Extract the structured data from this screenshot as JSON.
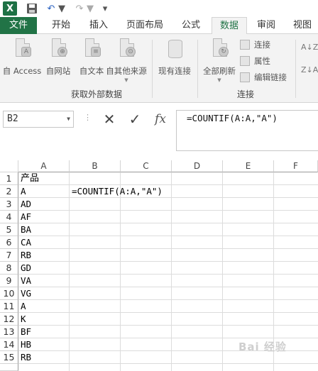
{
  "app": {
    "logo_letter": "X"
  },
  "quick_access": {
    "save_icon": "save-icon",
    "undo_icon": "undo-icon",
    "redo_icon": "redo-icon"
  },
  "tabs": [
    {
      "label": "文件"
    },
    {
      "label": "开始"
    },
    {
      "label": "插入"
    },
    {
      "label": "页面布局"
    },
    {
      "label": "公式"
    },
    {
      "label": "数据",
      "active": true
    },
    {
      "label": "审阅"
    },
    {
      "label": "视图"
    }
  ],
  "ribbon": {
    "get_external": {
      "label": "获取外部数据",
      "buttons": [
        {
          "label": "自 Access",
          "icon": "access-icon",
          "badge": "A"
        },
        {
          "label": "自网站",
          "icon": "web-icon",
          "badge": "⊕"
        },
        {
          "label": "自文本",
          "icon": "text-file-icon",
          "badge": "≡"
        },
        {
          "label": "自其他来源",
          "icon": "other-sources-icon",
          "badge": "⊙"
        }
      ]
    },
    "existing_connections": {
      "label": "现有连接",
      "icon": "database-icon"
    },
    "connections": {
      "label": "连接",
      "refresh_all": "全部刷新",
      "small": [
        {
          "label": "连接",
          "icon": "connections-icon"
        },
        {
          "label": "属性",
          "icon": "properties-icon"
        },
        {
          "label": "编辑链接",
          "icon": "edit-links-icon"
        }
      ]
    },
    "sort": {
      "az": "A↓Z",
      "za": "Z↓A"
    }
  },
  "formula_bar": {
    "name_box": "B2",
    "cancel_icon": "✕",
    "enter_icon": "✓",
    "fx_label": "fx",
    "formula": "=COUNTIF(A:A,\"A\")"
  },
  "sheet": {
    "columns": [
      "A",
      "B",
      "C",
      "D",
      "E",
      "F"
    ],
    "rows": [
      "1",
      "2",
      "3",
      "4",
      "5",
      "6",
      "7",
      "8",
      "9",
      "10",
      "11",
      "12",
      "13",
      "14",
      "15"
    ],
    "column_a": [
      "产品",
      "A",
      "AD",
      "AF",
      "BA",
      "CA",
      "RB",
      "GD",
      "VA",
      "VG",
      "A",
      "K",
      "BF",
      "HB",
      "RB"
    ],
    "b2_formula": "=COUNTIF(A:A,\"A\")"
  }
}
